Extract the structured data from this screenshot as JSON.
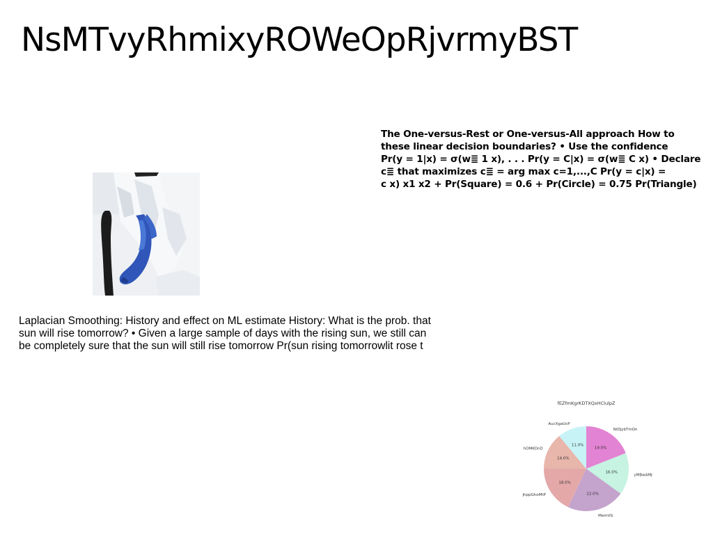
{
  "title": "NsMTvyRhmixyROWeOpRjvrmyBST",
  "bold_text": {
    "lines": [
      "The One-versus-Rest or One-versus-All approach How to",
      "these linear decision boundaries? • Use the confidence",
      "Pr(y = 1|x) = σ(w≣ 1 x), . . . Pr(y = C|x) = σ(w≣ C x) • Declare",
      "c≣ that maximizes c≣ = arg max c=1,...,C Pr(y = c|x) =",
      "c x) x1 x2 + Pr(Square) = 0.6 + Pr(Circle) = 0.75 Pr(Triangle)"
    ]
  },
  "body_text": {
    "lines": [
      "Laplacian Smoothing: History and effect on ML estimate History: What is the prob. that",
      "sun will rise tomorrow? • Given a large sample of days with the rising sun, we still can",
      "be completely sure that the sun will still rise tomorrow Pr(sun rising tomorrowlit rose t"
    ]
  },
  "chart_data": {
    "type": "pie",
    "title": "fEZfmKgrKDTXQxHClulpZ",
    "slices": [
      {
        "label": "NiDJybTmOn",
        "value": 19.0,
        "pct_label": "19.0%",
        "color": "#e383d3"
      },
      {
        "label": "yMBwAMJ",
        "value": 16.0,
        "pct_label": "16.0%",
        "color": "#c6f3e2"
      },
      {
        "label": "MemVG",
        "value": 22.0,
        "pct_label": "22.0%",
        "color": "#c4a3cd"
      },
      {
        "label": "jhppGhoMtP",
        "value": 18.0,
        "pct_label": "18.0%",
        "color": "#e4a8a9"
      },
      {
        "label": "hOMKOnD",
        "value": 14.0,
        "pct_label": "14.0%",
        "color": "#e8b6ab"
      },
      {
        "label": "AucXgaUcP",
        "value": 11.0,
        "pct_label": "11.0%",
        "color": "#c8f3f6"
      }
    ],
    "start_angle_deg": 90,
    "direction": "clockwise"
  }
}
